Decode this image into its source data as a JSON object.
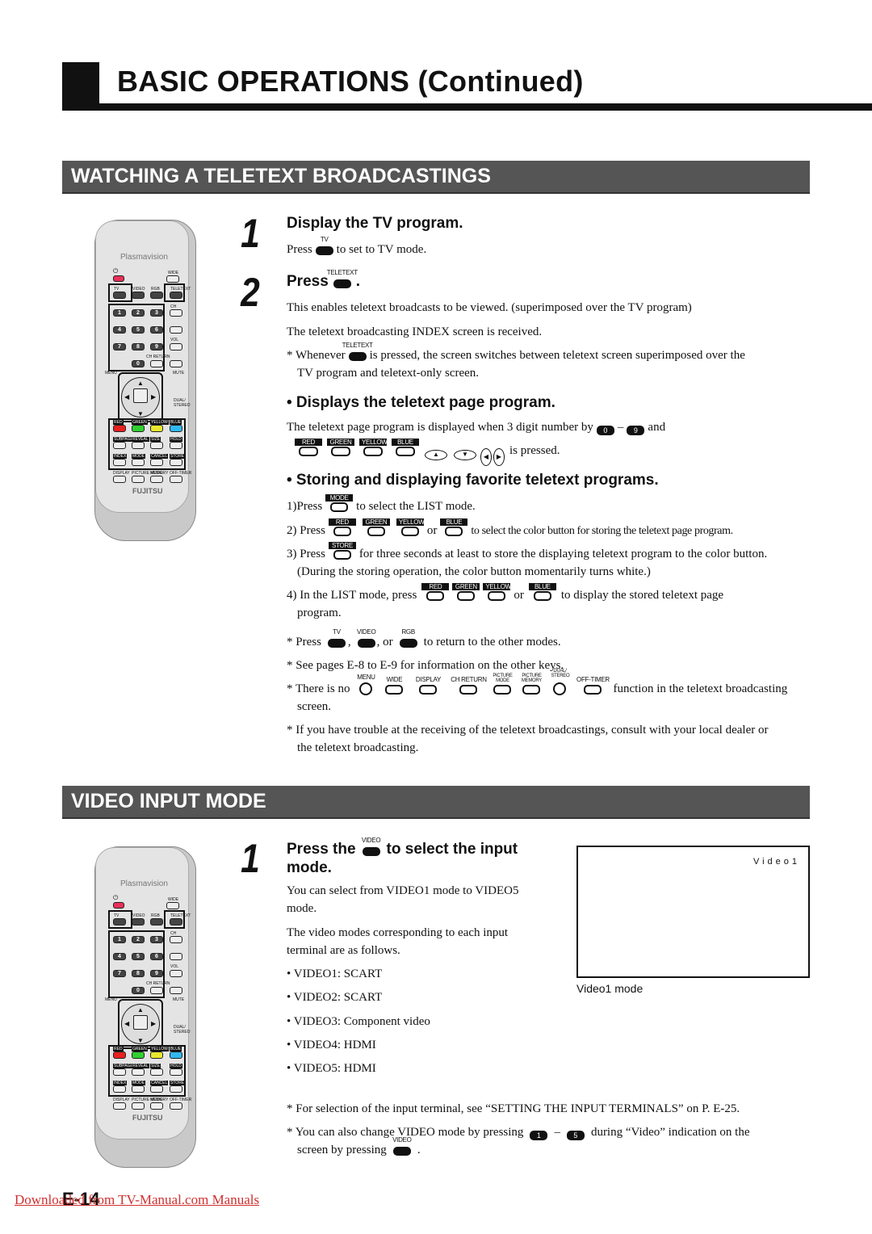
{
  "header": {
    "title": "BASIC OPERATIONS  (Continued)"
  },
  "remote": {
    "brand": "Plasmavision",
    "logo": "FUJITSU",
    "labels": {
      "wide": "WIDE",
      "tv": "TV",
      "video": "VIDEO",
      "rgb": "RGB",
      "teletext": "TELETEXT",
      "ch": "CH",
      "vol": "VOL",
      "chreturn": "CH RETURN",
      "menu": "MENU",
      "mute": "MUTE",
      "dual": "DUAL/ STEREO",
      "red": "RED",
      "green": "GREEN",
      "yellow": "YELLOW",
      "blue": "BLUE",
      "subpage": "SUBPAGE",
      "reveal": "REVEAL",
      "size": "SIZE",
      "hold": "HOLD",
      "index": "INDEX",
      "mode": "MODE",
      "cancel": "CANCEL",
      "store": "STORE",
      "display": "DISPLAY",
      "picmode": "PICTURE MODE",
      "memory": "MEMORY",
      "offtimer": "OFF-TIMER"
    },
    "digits": [
      "1",
      "2",
      "3",
      "4",
      "5",
      "6",
      "7",
      "8",
      "9",
      "0"
    ],
    "colors": {
      "power": "#e8305a",
      "red": "#e82020",
      "green": "#30d030",
      "yellow": "#e8e830",
      "blue": "#30b8f0"
    }
  },
  "teletext": {
    "section_title": "WATCHING A TELETEXT BROADCASTINGS",
    "step1": {
      "num": "1",
      "title": "Display the TV program.",
      "pre": "Press",
      "btn": "TV",
      "post": "to set to TV mode."
    },
    "step2": {
      "num": "2",
      "title": "Press",
      "btn": "TELETEXT",
      "title_end": ".",
      "p1": "This enables teletext broadcasts to be viewed. (superimposed over the TV program)",
      "p2": "The teletext broadcasting INDEX screen is received.",
      "note_pre": "* Whenever",
      "note_btn": "TELETEXT",
      "note_post": "is pressed, the screen switches between teletext screen superimposed over the",
      "note_cont": "TV program and teletext-only screen."
    },
    "page": {
      "title": "• Displays the teletext page program.",
      "l1_pre": "The teletext page program is displayed when 3 digit number by",
      "d0": "0",
      "dash": "–",
      "d9": "9",
      "l1_post": "and",
      "red": "RED",
      "green": "GREEN",
      "yellow": "YELLOW",
      "blue": "BLUE",
      "up": "▲",
      "down": "▼",
      "left": "◀",
      "right": "▶",
      "l2_post": "is pressed."
    },
    "fav": {
      "title": "• Storing and displaying favorite teletext programs.",
      "s1_pre": "1)Press",
      "s1_btn": "MODE",
      "s1_post": "to select the LIST mode.",
      "s2_pre": "2) Press",
      "red": "RED",
      "green": "GREEN",
      "yellow": "YELLOW",
      "or": "or",
      "blue": "BLUE",
      "s2_post": "to select the color button for storing the teletext page program.",
      "s3_pre": "3) Press",
      "s3_btn": "STORE",
      "s3_post": "for three seconds at least to store the displaying teletext program to the color button.",
      "s3_cont": "(During the storing operation, the color button momentarily turns white.)",
      "s4_pre": "4) In the LIST mode, press",
      "s4_post": "to display the stored teletext page",
      "s4_cont": "program."
    },
    "notes": {
      "n1_pre": "* Press",
      "tv": "TV",
      "comma": ",",
      "video": "VIDEO",
      "comma_or": ", or",
      "rgb": "RGB",
      "n1_post": "to return to the other modes.",
      "n2": "* See pages E-8 to E-9 for information on the other keys.",
      "n3_pre": "* There is no",
      "menu": "MENU",
      "wide": "WIDE",
      "display": "DISPLAY",
      "chreturn": "CH RETURN",
      "picmode": "PICTURE MODE",
      "picmem": "PICTURE MEMORY",
      "dual": "DUAL/ STEREO",
      "offtimer": "OFF-TIMER",
      "n3_post": "function in the teletext broadcasting",
      "n3_cont": "screen.",
      "n4": "* If you have trouble at the receiving of the teletext broadcastings, consult with your local dealer or",
      "n4_cont": "the teletext broadcasting."
    }
  },
  "video": {
    "section_title": "VIDEO INPUT MODE",
    "step1": {
      "num": "1",
      "title_pre": "Press the",
      "btn": "VIDEO",
      "title_post": "to select the input",
      "title_cont": "mode.",
      "p1": "You can select from VIDEO1 mode to VIDEO5",
      "p1_cont": "mode.",
      "p2": "The video modes corresponding to each input",
      "p2_cont": "terminal are as follows.",
      "list": [
        "VIDEO1: SCART",
        "VIDEO2: SCART",
        "VIDEO3: Component video",
        "VIDEO4: HDMI",
        "VIDEO5: HDMI"
      ]
    },
    "screen": {
      "label": "Video1",
      "caption": "Video1 mode"
    },
    "note1": "* For selection of the input terminal, see “SETTING THE INPUT TERMINALS” on P. E-25.",
    "note2_pre": "* You can also change VIDEO mode by pressing",
    "d1": "1",
    "dash": "–",
    "d5": "5",
    "note2_post": "during “Video” indication on the",
    "note2_cont_pre": "screen by pressing",
    "note2_btn": "VIDEO",
    "note2_end": "."
  },
  "footer": {
    "page": "E-14",
    "link": "Downloaded from TV-Manual.com Manuals"
  }
}
